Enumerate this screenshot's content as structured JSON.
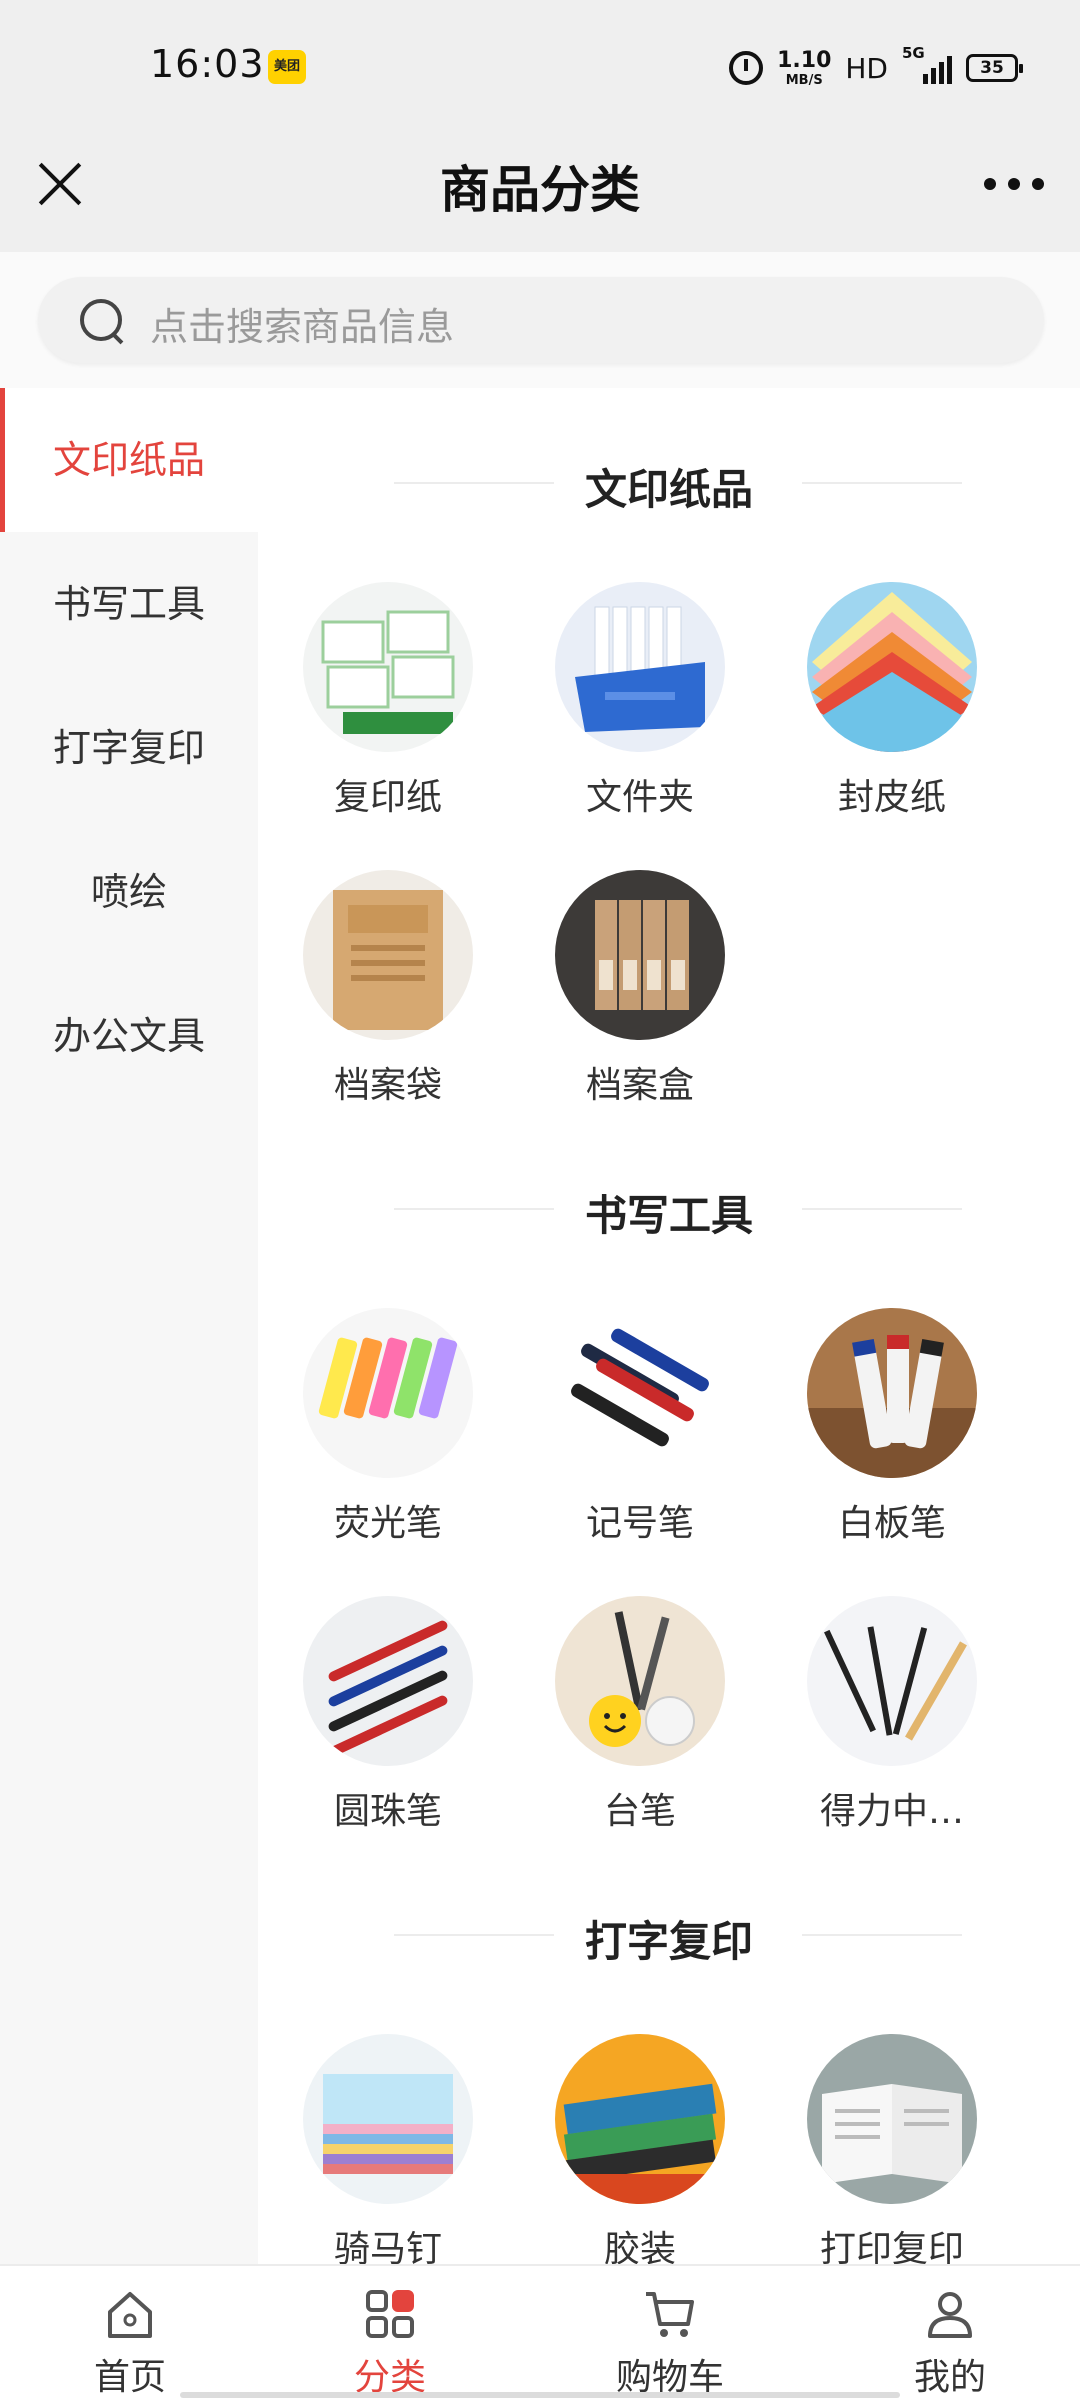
{
  "status_bar": {
    "time": "16:03",
    "app_badge": "美团",
    "net_speed": "1.10",
    "net_speed_unit": "MB/S",
    "hd": "HD",
    "network": "5G",
    "battery": "35"
  },
  "nav": {
    "title": "商品分类",
    "close_icon": "close-icon",
    "more_icon": "more-icon"
  },
  "search": {
    "placeholder": "点击搜索商品信息"
  },
  "sidebar": {
    "active_color": "#e3443d",
    "items": [
      {
        "label": "文印纸品",
        "active": true
      },
      {
        "label": "书写工具",
        "active": false
      },
      {
        "label": "打字复印",
        "active": false
      },
      {
        "label": "喷绘",
        "active": false
      },
      {
        "label": "办公文具",
        "active": false
      }
    ]
  },
  "sections": [
    {
      "title": "文印纸品",
      "items": [
        {
          "label": "复印纸"
        },
        {
          "label": "文件夹"
        },
        {
          "label": "封皮纸"
        },
        {
          "label": "档案袋"
        },
        {
          "label": "档案盒"
        }
      ]
    },
    {
      "title": "书写工具",
      "items": [
        {
          "label": "荧光笔"
        },
        {
          "label": "记号笔"
        },
        {
          "label": "白板笔"
        },
        {
          "label": "圆珠笔"
        },
        {
          "label": "台笔"
        },
        {
          "label": "得力中…"
        }
      ]
    },
    {
      "title": "打字复印",
      "items": [
        {
          "label": "骑马钉"
        },
        {
          "label": "胶装"
        },
        {
          "label": "打印复印"
        }
      ]
    }
  ],
  "tabbar": {
    "items": [
      {
        "label": "首页",
        "icon": "home-icon",
        "active": false
      },
      {
        "label": "分类",
        "icon": "category-icon",
        "active": true
      },
      {
        "label": "购物车",
        "icon": "cart-icon",
        "active": false
      },
      {
        "label": "我的",
        "icon": "user-icon",
        "active": false
      }
    ]
  }
}
